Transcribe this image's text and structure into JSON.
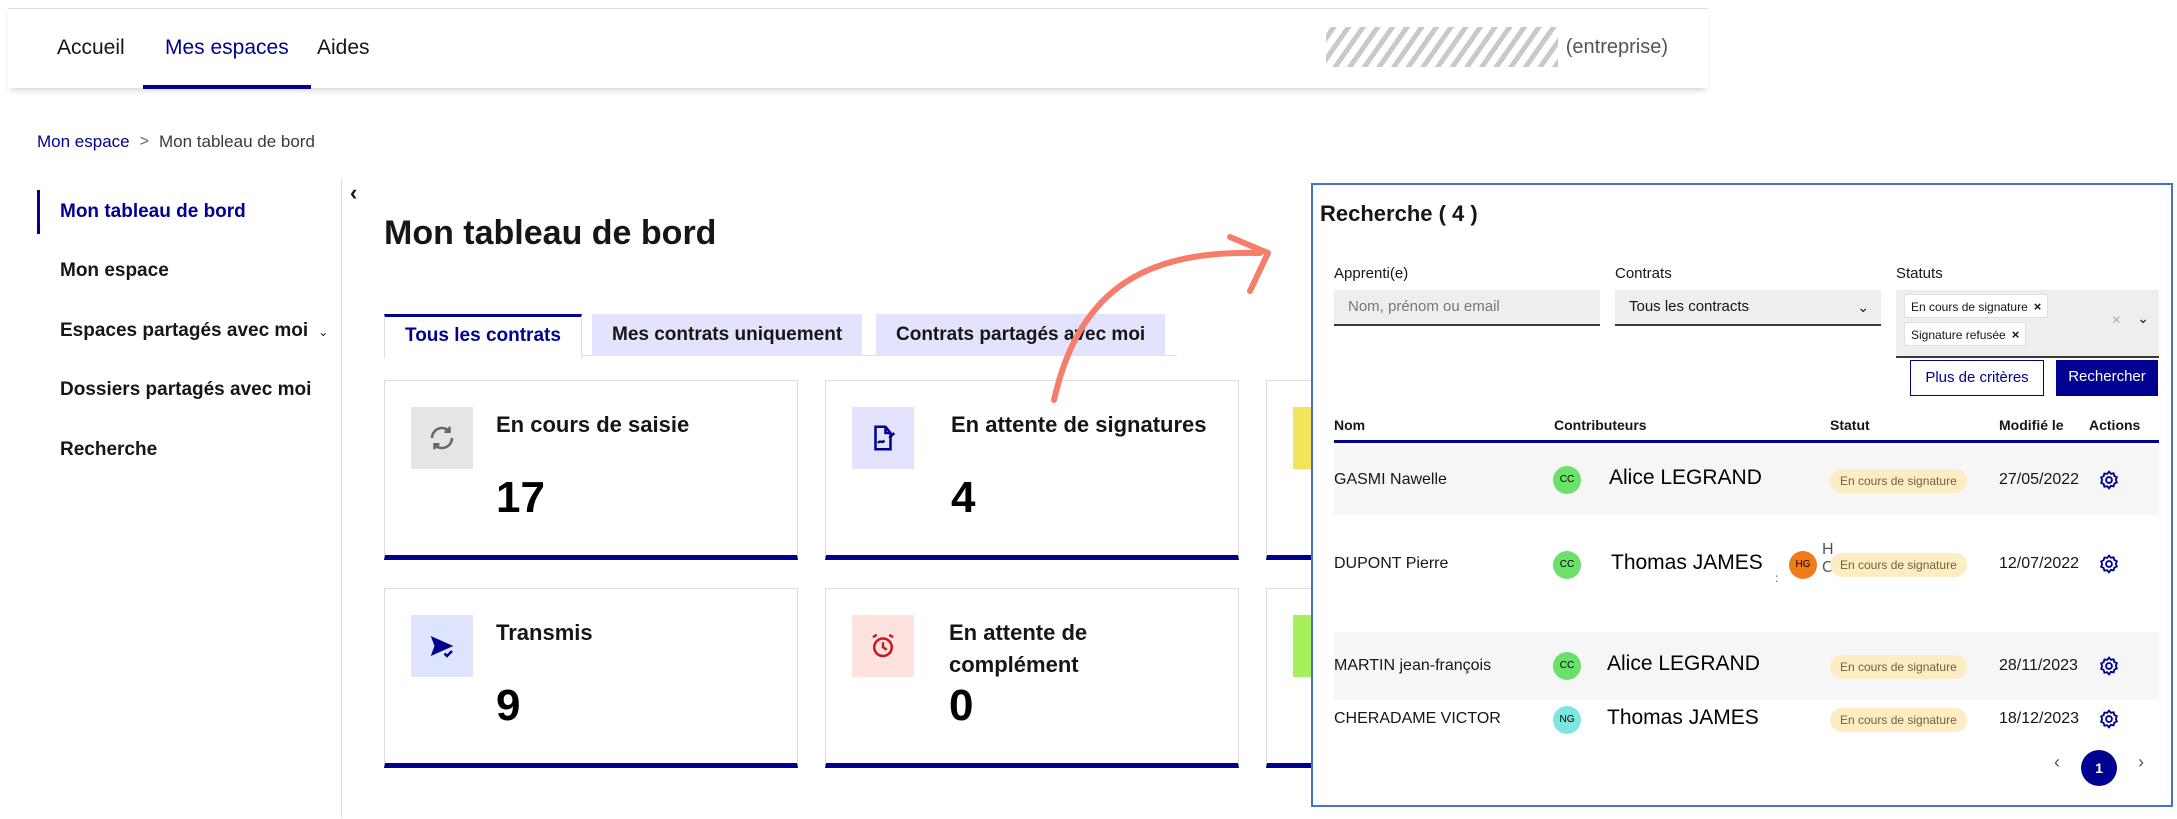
{
  "nav": {
    "tabs": [
      "Accueil",
      "Mes espaces",
      "Aides"
    ],
    "active_tab": "Mes espaces",
    "user_suffix": "(entreprise)"
  },
  "breadcrumb": {
    "items": [
      "Mon espace",
      "Mon tableau de bord"
    ]
  },
  "sidebar": {
    "items": [
      {
        "label": "Mon tableau de bord",
        "active": true
      },
      {
        "label": "Mon espace"
      },
      {
        "label": "Espaces partagés avec moi",
        "icon": "chevron-down-icon"
      },
      {
        "label": "Dossiers partagés avec moi"
      },
      {
        "label": "Recherche"
      }
    ],
    "collapse_icon": "chevron-left-icon"
  },
  "main": {
    "title": "Mon tableau de bord",
    "tabs": [
      "Tous les contrats",
      "Mes contrats uniquement",
      "Contrats partagés avec moi"
    ],
    "active_tab": "Tous les contrats",
    "cards": [
      {
        "label": "En cours de saisie",
        "count": "17",
        "icon": "refresh-icon",
        "icon_bg": "#e5e5e5",
        "icon_color": "#666666"
      },
      {
        "label": "En attente de signatures",
        "count": "4",
        "icon": "signature-icon",
        "icon_bg": "#e3e3fd",
        "icon_color": "#000091"
      },
      {
        "label": "Transmis",
        "count": "9",
        "icon": "send-icon",
        "icon_bg": "#dde4fb",
        "icon_color": "#000091"
      },
      {
        "label": "En attente de complément",
        "count": "0",
        "icon": "alarm-clock-icon",
        "icon_bg": "#fde2e0",
        "icon_color": "#c9191e"
      }
    ],
    "stub_colors": [
      "#f2e45b",
      "#a6f05a"
    ]
  },
  "search": {
    "title": "Recherche ( 4 )",
    "filters": {
      "apprenti_label": "Apprenti(e)",
      "apprenti_placeholder": "Nom, prénom ou email",
      "contrats_label": "Contrats",
      "contrats_value": "Tous les contracts",
      "statuts_label": "Statuts",
      "statuts_chips": [
        "En cours de signature",
        "Signature refusée"
      ]
    },
    "more_button": "Plus de critères",
    "search_button": "Rechercher",
    "columns": [
      "Nom",
      "Contributeurs",
      "Statut",
      "Modifié le",
      "Actions"
    ],
    "rows": [
      {
        "nom": "GASMI Nawelle",
        "avatar": "CC",
        "avatar_color": "#6be06b",
        "contributeur": "Alice LEGRAND",
        "statut": "En cours de signature",
        "date": "27/05/2022"
      },
      {
        "nom": "DUPONT Pierre",
        "avatar": "CC",
        "avatar_color": "#6be06b",
        "contributeur": "Thomas JAMES",
        "extra_avatar": "HG",
        "extra_avatar_color": "#f07b1a",
        "extra_letters": [
          "H",
          "C"
        ],
        "extra_mark": ":",
        "statut": "En cours de signature",
        "date": "12/07/2022"
      },
      {
        "nom": "MARTIN jean-françois",
        "avatar": "CC",
        "avatar_color": "#6be06b",
        "contributeur": "Alice LEGRAND",
        "statut": "En cours de signature",
        "date": "28/11/2023"
      },
      {
        "nom": "CHERADAME VICTOR",
        "avatar": "NG",
        "avatar_color": "#7fe5e0",
        "contributeur": "Thomas JAMES",
        "statut": "En cours de signature",
        "date": "18/12/2023"
      }
    ],
    "pagination": {
      "prev": "‹",
      "current": "1",
      "next": "›"
    }
  }
}
